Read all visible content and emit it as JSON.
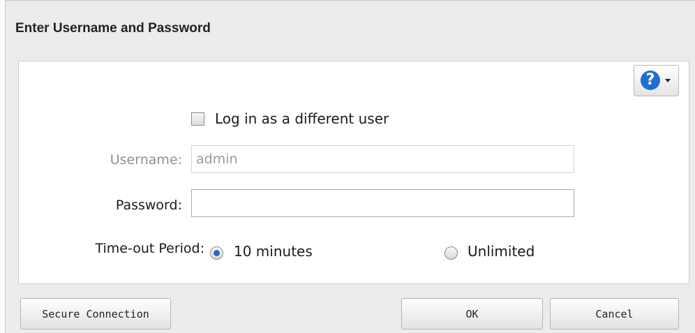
{
  "dialog": {
    "title": "Enter Username and Password"
  },
  "help_button": {
    "icon": "help-icon",
    "symbol": "?",
    "accent_color": "#1f6fd0"
  },
  "login_form": {
    "different_user_label": "Log in as a different user",
    "different_user_checked": false,
    "username_label": "Username:",
    "username_value": "admin",
    "username_disabled": true,
    "password_label": "Password:",
    "password_value": "",
    "timeout_label": "Time-out Period:",
    "timeout_options": [
      {
        "label": "10 minutes",
        "selected": true
      },
      {
        "label": "Unlimited",
        "selected": false
      }
    ]
  },
  "footer": {
    "secure_connection_label": "Secure Connection",
    "ok_label": "OK",
    "cancel_label": "Cancel"
  }
}
